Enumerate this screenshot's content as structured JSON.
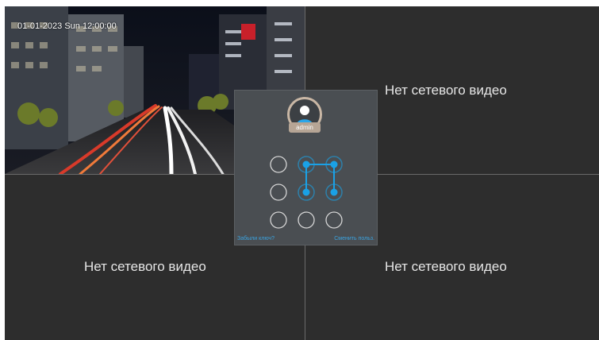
{
  "camera_views": {
    "channel_1": {
      "timestamp": "01-01-2023 Sun 12:00:00"
    },
    "channel_2": {
      "status": "Нет сетевого видео"
    },
    "channel_3": {
      "status": "Нет сетевого видео"
    },
    "channel_4": {
      "status": "Нет сетевого видео"
    }
  },
  "login": {
    "username": "admin",
    "forgot_link": "Забыли ключ?",
    "switch_user_link": "Сменить польз.",
    "pattern_selected_dots": [
      1,
      2,
      4,
      5
    ]
  },
  "colors": {
    "accent": "#1aa1e6",
    "panel_bg": "#4a4e52",
    "view_bg": "#2d2d2d"
  }
}
